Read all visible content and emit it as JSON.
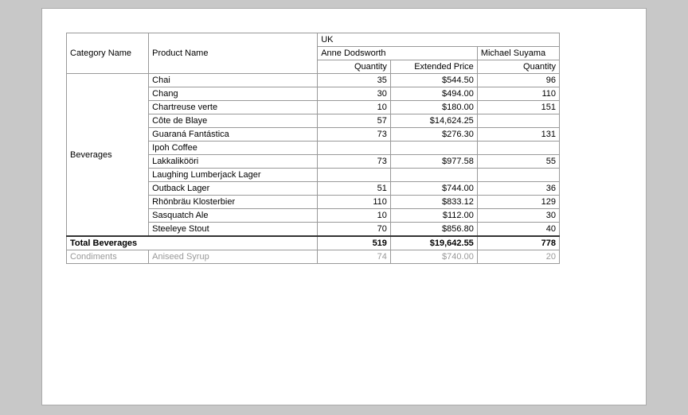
{
  "table": {
    "headers": {
      "col1": "Category Name",
      "col2": "Product Name",
      "region": "UK",
      "person1": "Anne Dodsworth",
      "person2": "Michael Suyama",
      "qty1": "Quantity",
      "extPrice": "Extended Price",
      "qty2": "Quantity"
    },
    "rows": [
      {
        "category": "Beverages",
        "product": "Chai",
        "qty1": "35",
        "ext": "$544.50",
        "qty2": "96"
      },
      {
        "category": "",
        "product": "Chang",
        "qty1": "30",
        "ext": "$494.00",
        "qty2": "110"
      },
      {
        "category": "",
        "product": "Chartreuse verte",
        "qty1": "10",
        "ext": "$180.00",
        "qty2": "151"
      },
      {
        "category": "",
        "product": "Côte de Blaye",
        "qty1": "57",
        "ext": "$14,624.25",
        "qty2": ""
      },
      {
        "category": "",
        "product": "Guaraná Fantástica",
        "qty1": "73",
        "ext": "$276.30",
        "qty2": "131"
      },
      {
        "category": "",
        "product": "Ipoh Coffee",
        "qty1": "",
        "ext": "",
        "qty2": ""
      },
      {
        "category": "",
        "product": "Lakkalikööri",
        "qty1": "73",
        "ext": "$977.58",
        "qty2": "55"
      },
      {
        "category": "",
        "product": "Laughing Lumberjack Lager",
        "qty1": "",
        "ext": "",
        "qty2": ""
      },
      {
        "category": "",
        "product": "Outback Lager",
        "qty1": "51",
        "ext": "$744.00",
        "qty2": "36"
      },
      {
        "category": "",
        "product": "Rhönbräu Klosterbier",
        "qty1": "110",
        "ext": "$833.12",
        "qty2": "129"
      },
      {
        "category": "",
        "product": "Sasquatch Ale",
        "qty1": "10",
        "ext": "$112.00",
        "qty2": "30"
      },
      {
        "category": "",
        "product": "Steeleye Stout",
        "qty1": "70",
        "ext": "$856.80",
        "qty2": "40"
      }
    ],
    "total": {
      "label": "Total Beverages",
      "qty1": "519",
      "ext": "$19,642.55",
      "qty2": "778"
    },
    "next_row": {
      "category": "Condiments",
      "product": "Aniseed Syrup",
      "qty1": "74",
      "ext": "$740.00",
      "qty2": "20"
    }
  }
}
